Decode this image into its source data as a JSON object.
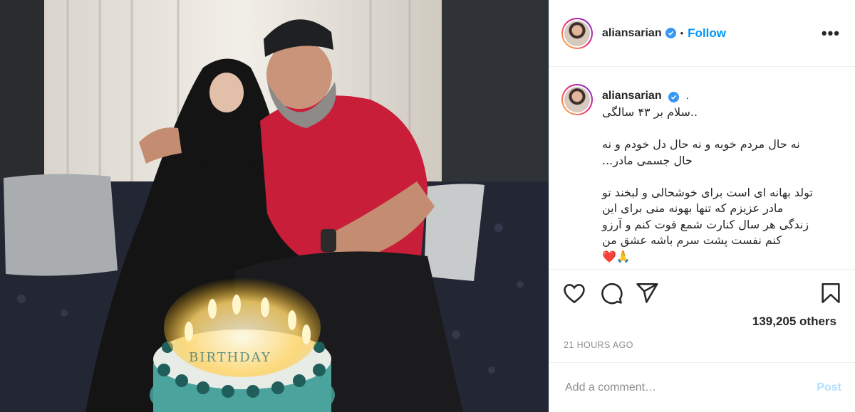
{
  "post": {
    "username": "aliansarian",
    "follow_label": "Follow",
    "separator": "•",
    "more_label": "•••",
    "caption_suffix": ".",
    "caption_text": "..سلام بر ۴۳ سالگی\n\nنه حال مردم خوبه و نه حال دل خودم و نه حال جسمی مادر...\n\nتولد بهانه ای است برای خوشحالی و لبخند تو مادر عزیزم که تنها بهونه منی برای این زندگی هر سال کنارت شمع فوت کنم و آرزو کنم نفست پشت سرم باشه عشق من\n🙏❤️",
    "likes_text": "139,205 others",
    "timestamp": "21 HOURS AGO",
    "comment_placeholder": "Add a comment…",
    "post_label": "Post",
    "cake_text": "BIRTHDAY"
  },
  "colors": {
    "accent": "#0095f6",
    "verified": "#3897f0",
    "muted": "#8e8e8e",
    "post_disabled": "#b2dffc"
  },
  "icons": [
    "verified-badge-icon",
    "more-options-icon",
    "heart-icon",
    "comment-icon",
    "share-icon",
    "bookmark-icon"
  ]
}
